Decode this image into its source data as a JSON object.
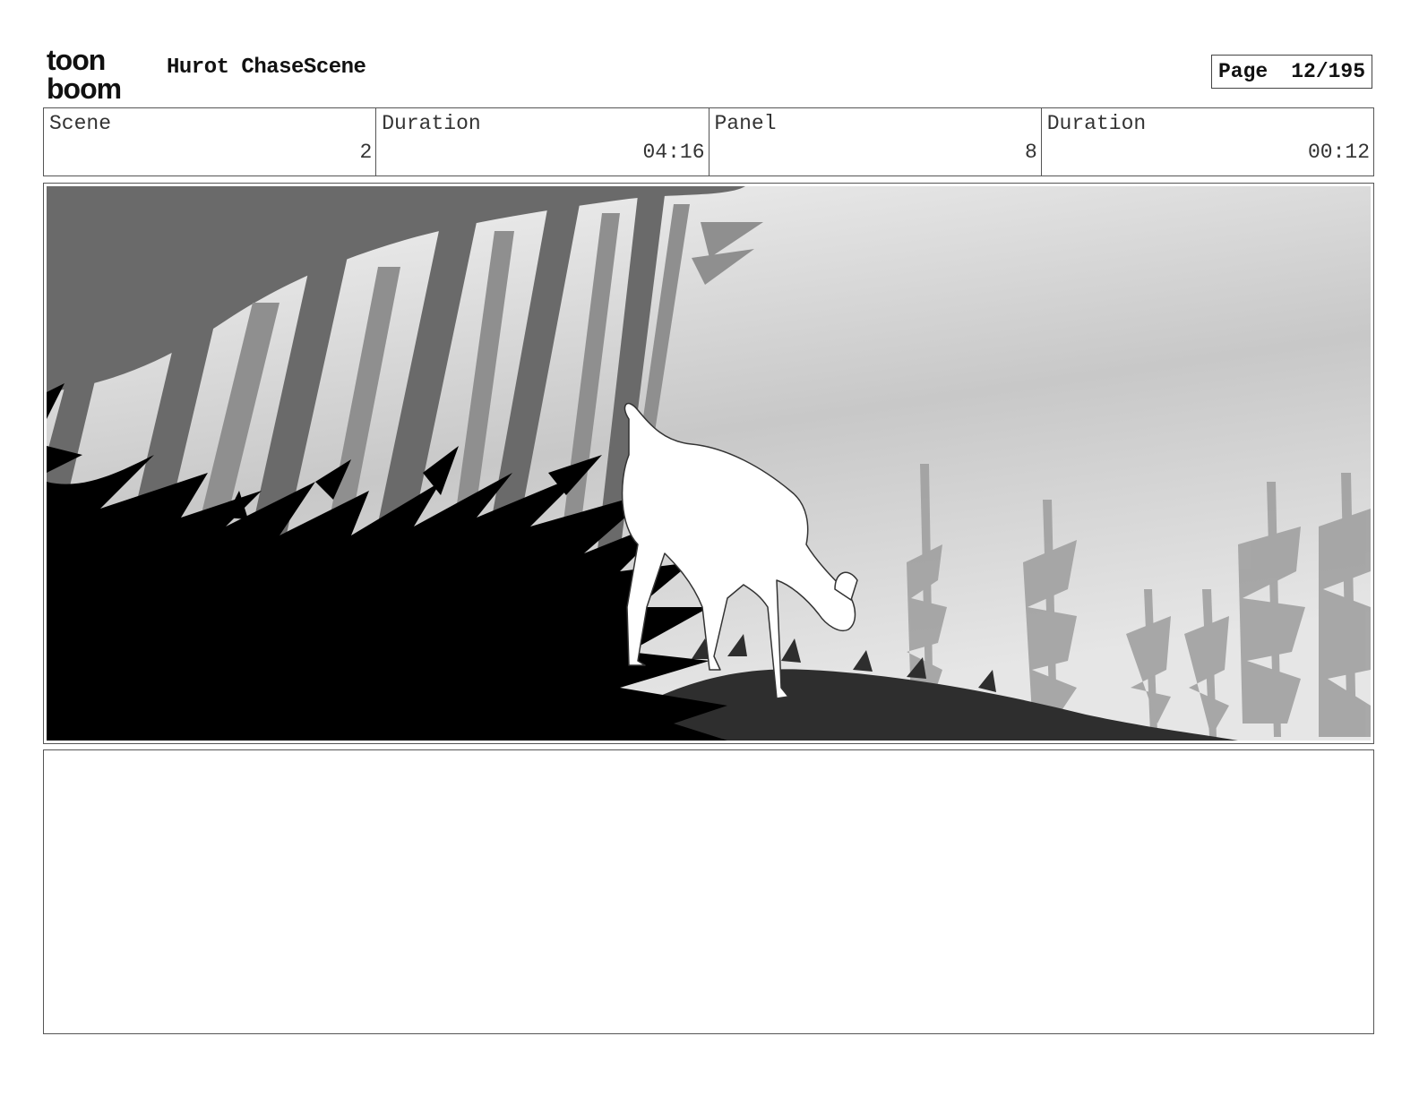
{
  "header": {
    "logo_line1": "toon",
    "logo_line2": "boom",
    "title": "Hurot ChaseScene",
    "page_label": "Page",
    "page_value": "12/195"
  },
  "meta": {
    "scene_label": "Scene",
    "scene_value": "2",
    "scene_duration_label": "Duration",
    "scene_duration_value": "04:16",
    "panel_label": "Panel",
    "panel_value": "8",
    "panel_duration_label": "Duration",
    "panel_duration_value": "00:12"
  },
  "colors": {
    "frame_border": "#555555",
    "foliage": "#000000",
    "tree_dark": "#6a6a6a",
    "tree_light": "#8f8f8f",
    "deer": "#ffffff"
  },
  "icons": [
    "toon-boom-logo"
  ]
}
